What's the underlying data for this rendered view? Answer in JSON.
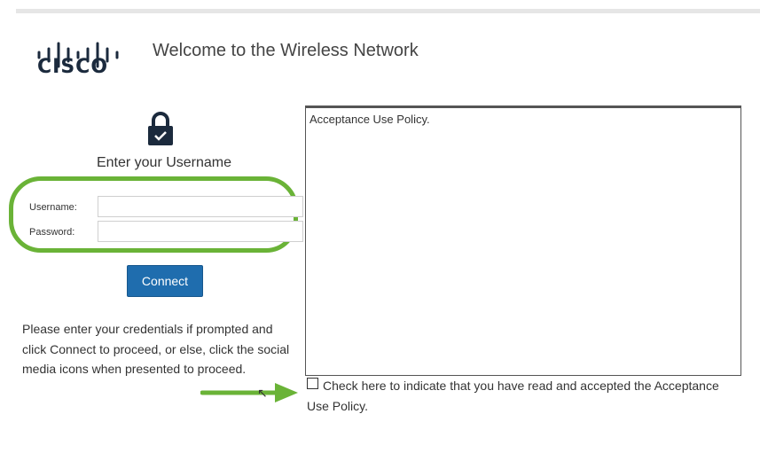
{
  "header": {
    "logo_text": "CISCO",
    "logo_icon": "cisco-bridge-logo",
    "title": "Welcome to the Wireless Network"
  },
  "login": {
    "icon": "lock-check-icon",
    "heading": "Enter your Username",
    "username_label": "Username:",
    "username_value": "",
    "password_label": "Password:",
    "password_value": "",
    "connect_label": "Connect",
    "instructions": "Please enter your credentials if prompted and click Connect to proceed, or else, click the social media icons when presented to proceed."
  },
  "policy": {
    "text": "Acceptance Use Policy.",
    "accept_label": "Check here to indicate that you have read and accepted the Acceptance Use Policy.",
    "accepted": false
  },
  "annotations": {
    "highlight_color": "#6ab337",
    "arrow_color": "#6ab337"
  },
  "colors": {
    "button_bg": "#1f6dae",
    "logo_color": "#1b2a3d"
  }
}
